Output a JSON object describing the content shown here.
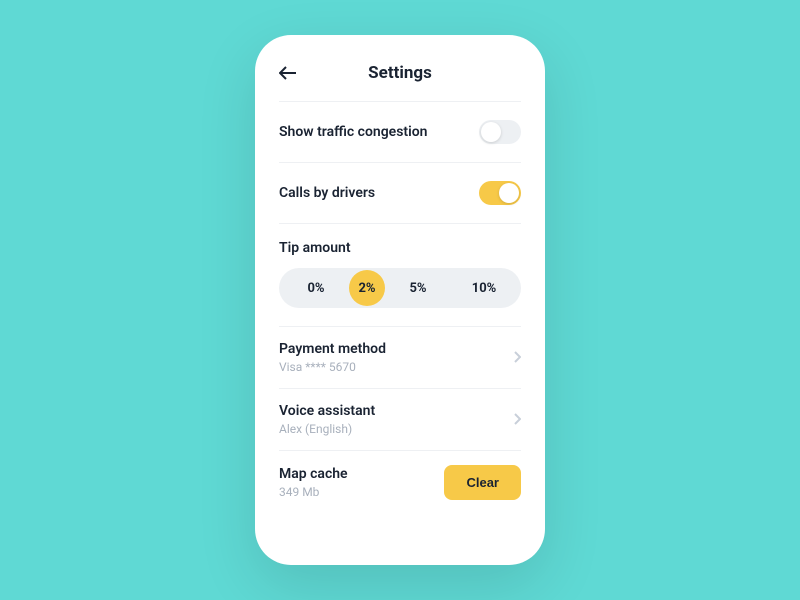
{
  "header": {
    "title": "Settings"
  },
  "toggles": {
    "traffic": {
      "label": "Show traffic congestion",
      "on": false
    },
    "calls": {
      "label": "Calls by drivers",
      "on": true
    }
  },
  "tip": {
    "title": "Tip amount",
    "options": [
      "0%",
      "2%",
      "5%",
      "10%"
    ],
    "selected": "2%"
  },
  "payment": {
    "title": "Payment method",
    "value": "Visa **** 5670"
  },
  "voice": {
    "title": "Voice assistant",
    "value": "Alex (English)"
  },
  "cache": {
    "title": "Map cache",
    "value": "349 Mb",
    "button": "Clear"
  }
}
